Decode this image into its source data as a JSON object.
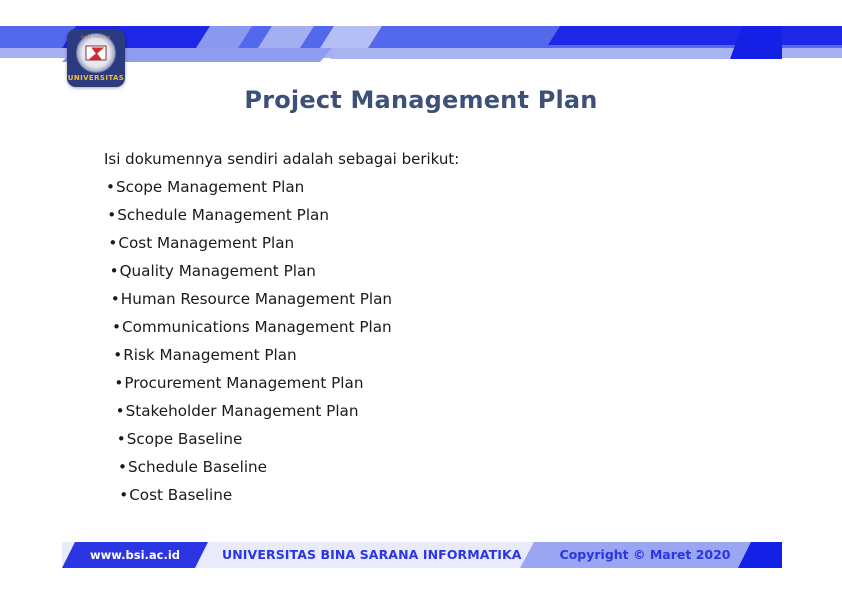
{
  "slide": {
    "title": "Project Management Plan",
    "intro": "Isi dokumennya sendiri adalah sebagai berikut:",
    "bullets": [
      "Scope Management Plan",
      "Schedule Management Plan",
      "Cost Management Plan",
      "Quality Management Plan",
      "Human Resource Management Plan",
      "Communications Management Plan",
      "Risk Management Plan",
      "Procurement Management Plan",
      "Stakeholder Management Plan",
      "Scope Baseline",
      "Schedule Baseline",
      "Cost Baseline"
    ],
    "bullet_char": "•"
  },
  "logo": {
    "caption": "UNIVERSITAS",
    "ring_text": "BINA SARANA",
    "icon": "university-seal-icon"
  },
  "footer": {
    "url": "www.bsi.ac.id",
    "institution": "UNIVERSITAS BINA SARANA INFORMATIKA",
    "copyright": "Copyright © Maret 2020"
  },
  "colors": {
    "title": "#3d5077",
    "brand_blue": "#2b35e3",
    "band_dark": "#1e26e8",
    "band_mid": "#5468ec",
    "band_light": "#a7b1f2",
    "footer_copy_bg": "#9aa6f2",
    "logo_navy": "#2c3a7e",
    "logo_gold": "#f0c23a",
    "seal_red": "#cf2b33"
  }
}
